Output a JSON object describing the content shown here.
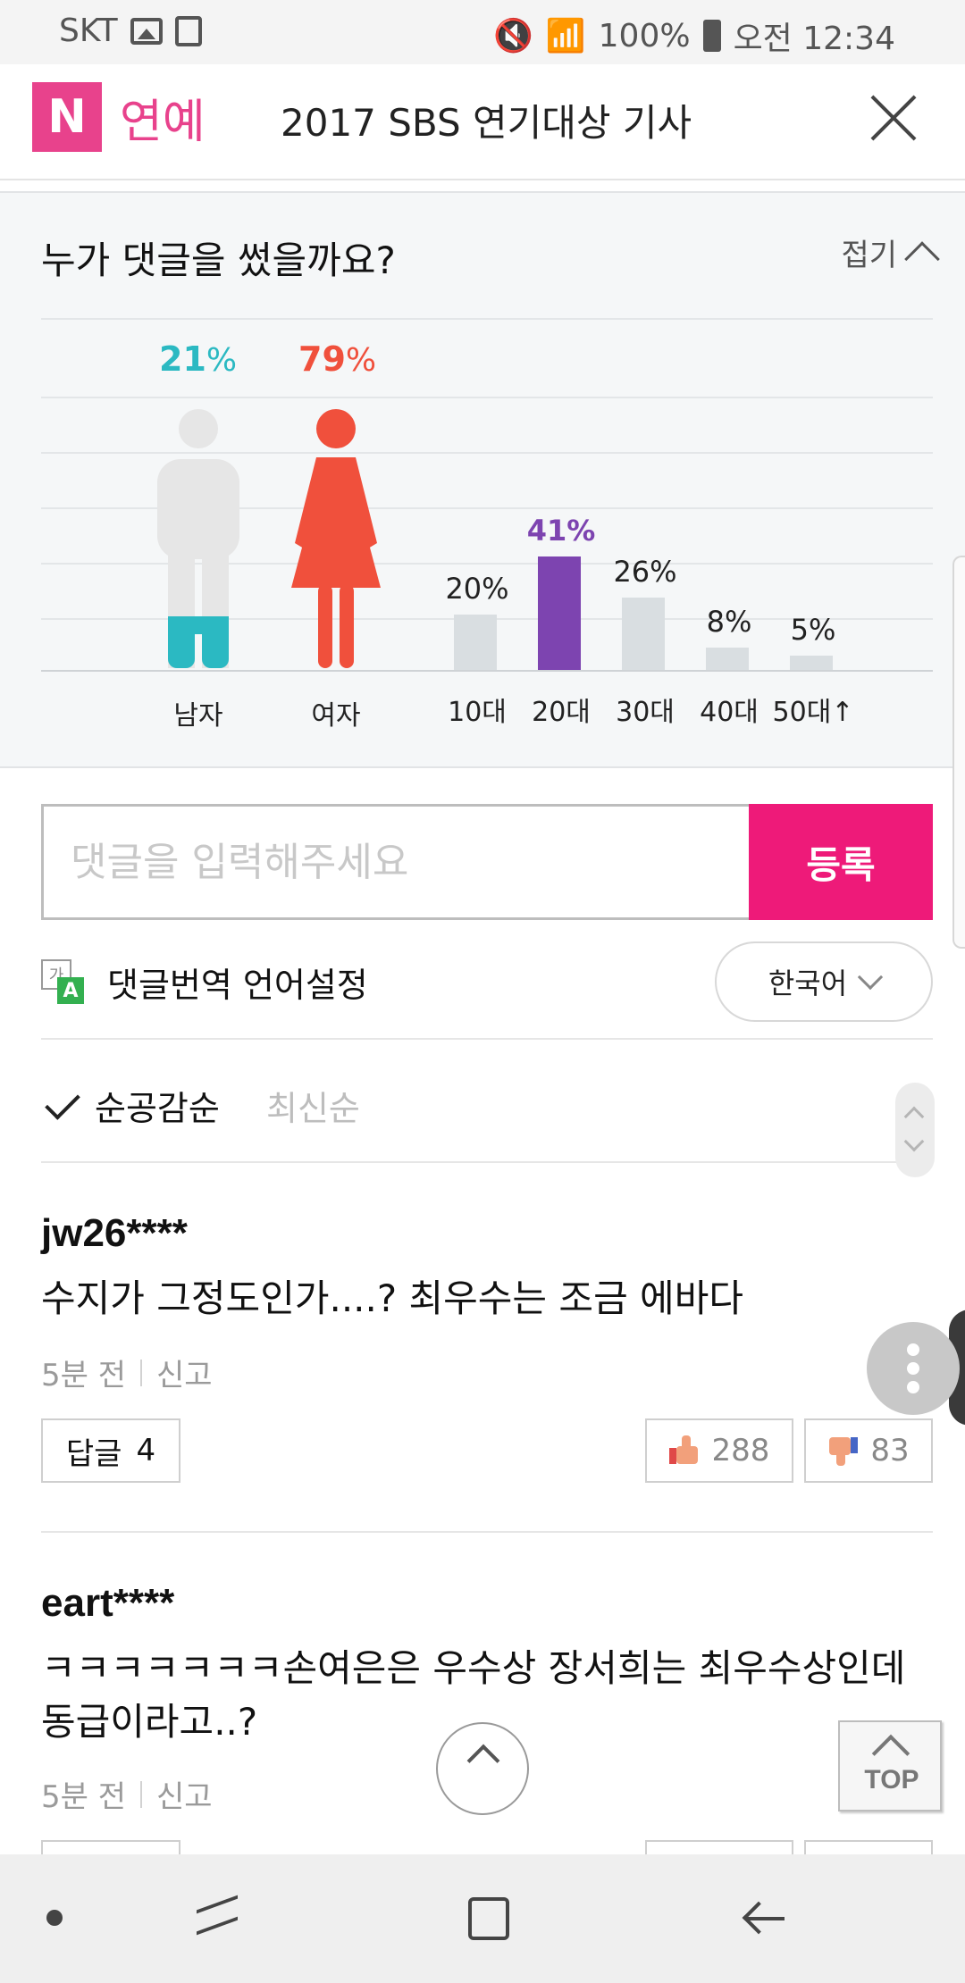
{
  "status_bar": {
    "carrier": "SKT",
    "battery": "100%",
    "time": "오전 12:34"
  },
  "header": {
    "logo_letter": "N",
    "logo_text": "연예",
    "title": "2017 SBS 연기대상 기사"
  },
  "stats": {
    "title": "누가 댓글을 썼을까요?",
    "fold_label": "접기",
    "gender": [
      {
        "label": "남자",
        "value": "21",
        "unit": "%",
        "color": "#2bb9c2"
      },
      {
        "label": "여자",
        "value": "79",
        "unit": "%",
        "color": "#f0503c"
      }
    ],
    "ages": [
      {
        "label": "10대",
        "value_text": "20%",
        "value": 20
      },
      {
        "label": "20대",
        "value_text": "41%",
        "value": 41,
        "highlight": true
      },
      {
        "label": "30대",
        "value_text": "26%",
        "value": 26
      },
      {
        "label": "40대",
        "value_text": "8%",
        "value": 8
      },
      {
        "label": "50대↑",
        "value_text": "5%",
        "value": 5
      }
    ],
    "highlight_color": "#7d44b0",
    "bar_color": "#d9dee1"
  },
  "comment_form": {
    "placeholder": "댓글을 입력해주세요",
    "submit_label": "등록"
  },
  "translation": {
    "icon_src": "가",
    "icon_dst": "A",
    "label": "댓글번역 언어설정",
    "language": "한국어"
  },
  "sort": {
    "best": "순공감순",
    "newest": "최신순"
  },
  "comments": [
    {
      "author": "jw26****",
      "text": "수지가 그정도인가....? 최우수는 조금 에바다",
      "time": "5분 전",
      "report": "신고",
      "reply_label": "답글",
      "reply_count": "4",
      "likes": "288",
      "dislikes": "83"
    },
    {
      "author": "eart****",
      "text": "ㅋㅋㅋㅋㅋㅋㅋ손여은은 우수상 장서희는 최우수상인데 동급이라고..?",
      "time": "5분 전",
      "report": "신고"
    }
  ],
  "top_button": "TOP",
  "accent_color": "#ee1a79"
}
